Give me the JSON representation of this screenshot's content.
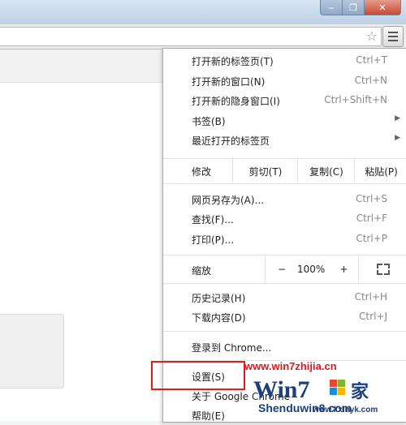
{
  "window": {
    "min_glyph": "‒",
    "max_glyph": "❐",
    "close_glyph": "✕"
  },
  "toolbar": {
    "star_icon": "☆"
  },
  "menu": {
    "items_top": [
      {
        "label": "打开新的标签页(T)",
        "shortcut": "Ctrl+T"
      },
      {
        "label": "打开新的窗口(N)",
        "shortcut": "Ctrl+N"
      },
      {
        "label": "打开新的隐身窗口(I)",
        "shortcut": "Ctrl+Shift+N"
      },
      {
        "label": "书签(B)",
        "submenu": "▶"
      },
      {
        "label": "最近打开的标签页",
        "submenu": "▶"
      }
    ],
    "edit": {
      "label": "修改",
      "cut": "剪切(T)",
      "copy": "复制(C)",
      "paste": "粘贴(P)"
    },
    "items_mid": [
      {
        "label": "网页另存为(A)...",
        "shortcut": "Ctrl+S"
      },
      {
        "label": "查找(F)...",
        "shortcut": "Ctrl+F"
      },
      {
        "label": "打印(P)...",
        "shortcut": "Ctrl+P"
      }
    ],
    "zoom": {
      "label": "缩放",
      "minus": "−",
      "value": "100%",
      "plus": "+"
    },
    "items_history": [
      {
        "label": "历史记录(H)",
        "shortcut": "Ctrl+H"
      },
      {
        "label": "下载内容(D)",
        "shortcut": "Ctrl+J"
      }
    ],
    "signin": "登录到 Chrome...",
    "settings": "设置(S)",
    "about": "关于 Google Chrome",
    "help": "帮助(E)"
  },
  "watermark": {
    "url": "www.win7zhijia.cn",
    "brand": "Win7",
    "site": "Shenduwin8.com",
    "sub": "www.kxinyk.com"
  },
  "colors": {
    "highlight": "#d9211b",
    "watermark_red": "#e4151b",
    "watermark_blue": "#1b3f80"
  }
}
